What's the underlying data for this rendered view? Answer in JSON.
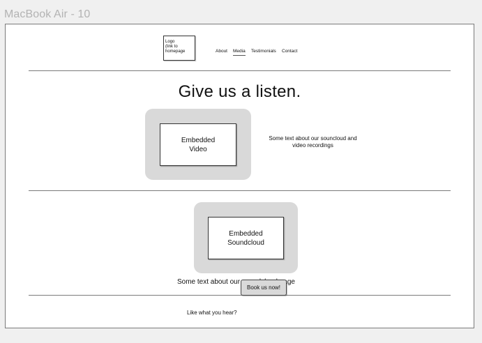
{
  "frame": {
    "label": "MacBook Air - 10"
  },
  "header": {
    "logo_text": "Logo\n(link to\nhomepage",
    "nav": [
      {
        "label": "About",
        "active": false
      },
      {
        "label": "Media",
        "active": true
      },
      {
        "label": "Testimonials",
        "active": false
      },
      {
        "label": "Contact",
        "active": false
      }
    ]
  },
  "main": {
    "title": "Give us a listen.",
    "video": {
      "placeholder": "Embedded\nVideo",
      "description": "Some text about our souncloud and\nvideo recordings"
    },
    "soundcloud": {
      "placeholder": "Embedded\nSoundcloud",
      "description": "Some text about our soundcloud page"
    }
  },
  "footer": {
    "prompt": "Like what you hear?",
    "cta_label": "Book us now!"
  },
  "colors": {
    "panel_grey": "#d9d9d9",
    "divider": "#7a7a7a",
    "frame_label": "#b3b3b3"
  }
}
